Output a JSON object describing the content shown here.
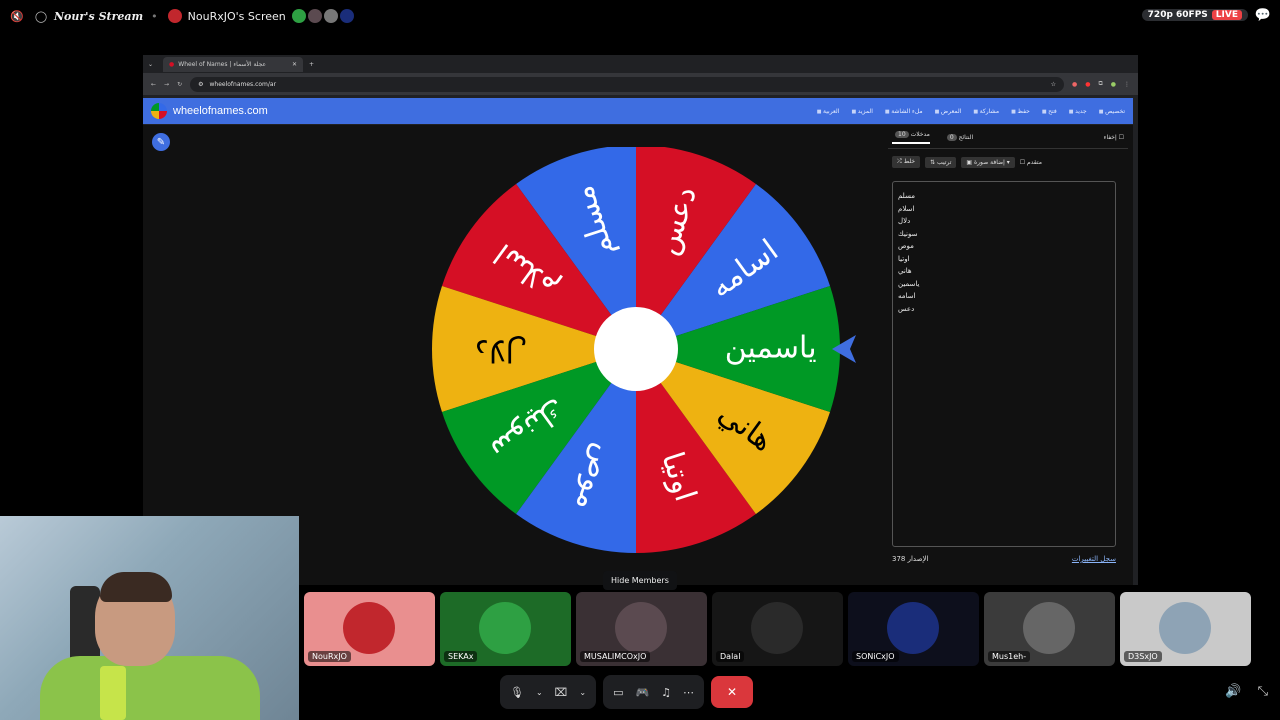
{
  "stream": {
    "stream_name": "Nour's Stream",
    "screen_title": "NouRxJO's Screen",
    "quality": "720p 60FPS",
    "live": "LIVE"
  },
  "browser": {
    "tab_title": "Wheel of Names | عجلة الأسماء",
    "url": "wheelofnames.com/ar"
  },
  "site": {
    "name": "wheelofnames.com",
    "menu": [
      "العربية",
      "المزيد",
      "ملء الشاشة",
      "المعرض",
      "مشاركة",
      "حفظ",
      "فتح",
      "جديد",
      "تخصيص"
    ]
  },
  "wheel": {
    "segments": [
      "اسامه",
      "دعس",
      "مسلم",
      "اسلام",
      "دلال",
      "سونيك",
      "موص",
      "اوتيا",
      "هاني",
      "ياسمين"
    ],
    "colors": [
      "#3369e8",
      "#d50f25",
      "#3369e8",
      "#d50f25",
      "#eeb211",
      "#009925",
      "#3369e8",
      "#d50f25",
      "#eeb211",
      "#009925"
    ]
  },
  "sidebar": {
    "hide_label": "إخفاء",
    "tab_entries": "مدخلات",
    "entries_count": "10",
    "tab_results": "النتائج",
    "results_count": "0",
    "tool_shuffle": "خلط",
    "tool_sort": "ترتيب",
    "tool_add_image": "إضافة صورة",
    "tool_advanced": "متقدم",
    "entries": [
      "مسلم",
      "اسلام",
      "دلال",
      "سونيك",
      "موص",
      "اوتيا",
      "هاني",
      "ياسمين",
      "اسامه",
      "دعس"
    ],
    "version": "الإصدار 378",
    "changelog": "سجل التغييرات"
  },
  "members_bar": {
    "hide_members": "Hide Members",
    "members": [
      {
        "name": "NouRxJO",
        "bg": "#e98f8f",
        "avatar": "#c1272d"
      },
      {
        "name": "SEKAx",
        "bg": "#1d6b27",
        "avatar": "#2ea043"
      },
      {
        "name": "MUSALIMCOxJO",
        "bg": "#3a3034",
        "avatar": "#5b4a50"
      },
      {
        "name": "Dalal",
        "bg": "#161616",
        "avatar": "#2a2a2a"
      },
      {
        "name": "SONiCxJO",
        "bg": "#0d0f1c",
        "avatar": "#1a2d7a"
      },
      {
        "name": "Mus1eh-",
        "bg": "#3b3b3b",
        "avatar": "#666666"
      },
      {
        "name": "D3SxJO",
        "bg": "#c9c9c9",
        "avatar": "#8ea3b5"
      }
    ]
  },
  "icons": {
    "mic": "microphone-icon",
    "camera": "camera-off-icon",
    "screen": "screen-share-icon",
    "activity": "gamepad-icon",
    "soundboard": "soundboard-icon",
    "more": "more-icon",
    "leave": "leave-call-icon",
    "volume": "volume-icon",
    "collapse": "collapse-icon"
  }
}
